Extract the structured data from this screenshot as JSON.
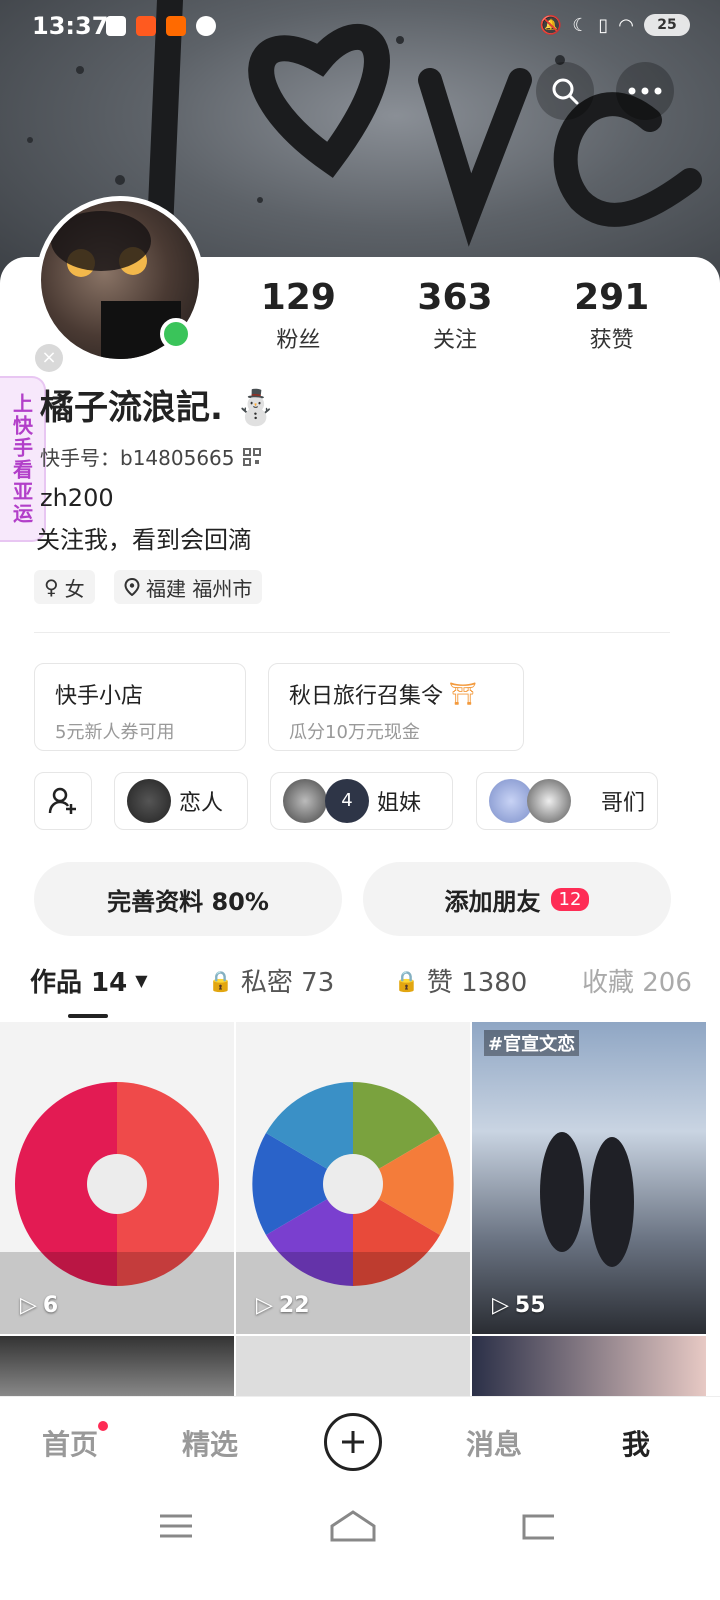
{
  "status_bar": {
    "time": "13:37",
    "battery": "25"
  },
  "stats": [
    {
      "num": "129",
      "label": "粉丝"
    },
    {
      "num": "363",
      "label": "关注"
    },
    {
      "num": "291",
      "label": "获赞"
    }
  ],
  "side_banner": {
    "label": "上快手看亚运"
  },
  "profile": {
    "name": "橘子流浪記.",
    "kuaishou_id": "快手号：b14805665",
    "bio_line1": "zh200",
    "bio_line2": "关注我，看到会回滴",
    "gender_tag": "女",
    "location_tag": "福建 福州市"
  },
  "promos": [
    {
      "title": "快手小店",
      "subtitle": "5元新人券可用"
    },
    {
      "title": "秋日旅行召集令",
      "subtitle": "瓜分10万元现金"
    }
  ],
  "groups": [
    {
      "label": "恋人"
    },
    {
      "label": "姐妹",
      "count": "4"
    },
    {
      "label": "哥们"
    }
  ],
  "actions": {
    "complete_profile": "完善资料 80%",
    "add_friend": "添加朋友",
    "add_friend_badge": "12"
  },
  "tabs": [
    {
      "label": "作品 14"
    },
    {
      "label": "私密 73"
    },
    {
      "label": "赞 1380"
    },
    {
      "label": "收藏 206"
    }
  ],
  "posts": [
    {
      "plays": "6",
      "overlay": ""
    },
    {
      "plays": "22",
      "overlay": ""
    },
    {
      "plays": "55",
      "overlay": "#官宣文恋"
    }
  ],
  "bottom_nav": [
    "首页",
    "精选",
    "消息",
    "我"
  ],
  "colors": {
    "accent": "#fe2c55",
    "online": "#3ac45a"
  }
}
